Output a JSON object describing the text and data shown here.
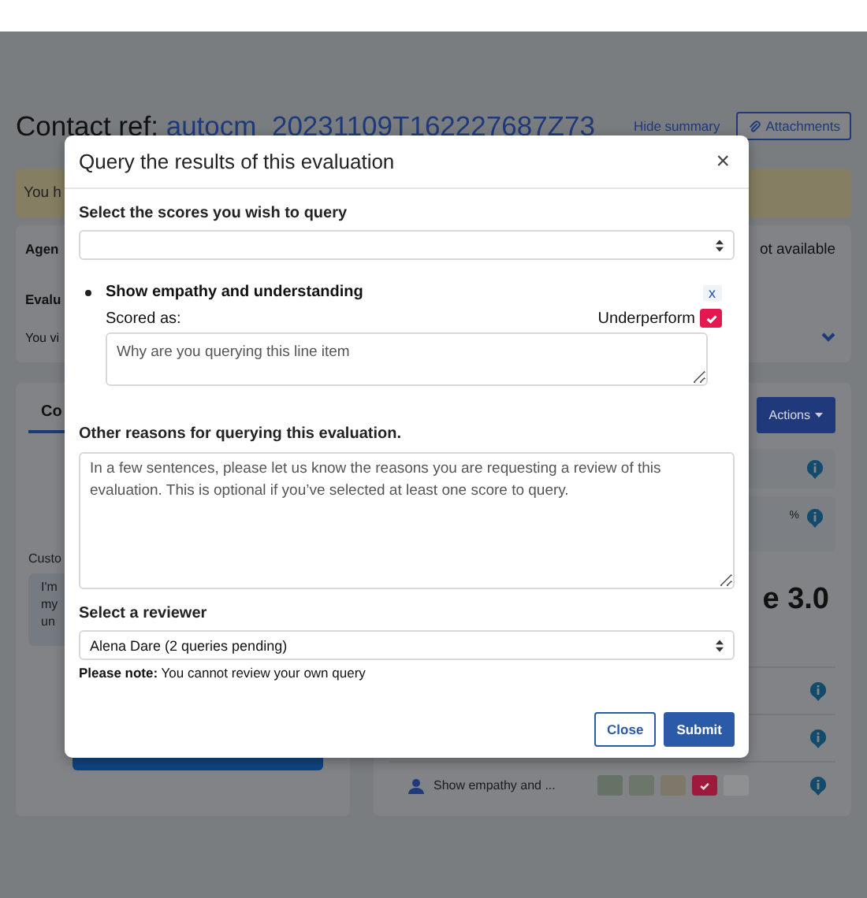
{
  "page": {
    "heading": "Contact ref:",
    "contact_ref": "autocm_20231109T162227687Z73",
    "hide_summary": "Hide summary",
    "attachments": "Attachments",
    "alert_text": "You h",
    "summary": {
      "agent_label": "Agen",
      "status_text": "ot available",
      "evaluation_label": "Evalu",
      "evaluation_text": "You vi"
    },
    "left_tab": "Co",
    "customer_label": "Custo",
    "message_lines": [
      "I'm",
      "my",
      "un"
    ],
    "actions": "Actions",
    "percent": "%",
    "score_title": "e 3.0",
    "score_row": {
      "label": "Show empathy and ...",
      "chips": [
        {
          "color": "#667266",
          "selected": false
        },
        {
          "color": "#6d766b",
          "selected": false
        },
        {
          "color": "#7d786a",
          "selected": false
        },
        {
          "color": "#9e1a3c",
          "selected": true
        },
        {
          "color": "#8e9092",
          "selected": false
        }
      ]
    }
  },
  "modal": {
    "title": "Query the results of this evaluation",
    "close": "×",
    "scores_label": "Select the scores you wish to query",
    "items": [
      {
        "name": "Show empathy and understanding",
        "remove": "x",
        "scored_label": "Scored as:",
        "score": "Underperform",
        "score_checked": true,
        "placeholder": "Why are you querying this line item"
      }
    ],
    "other_label": "Other reasons for querying this evaluation.",
    "other_placeholder": "In a few sentences, please let us know the reasons you are requesting a review of this evaluation. This is optional if you’ve selected at least one score to query.",
    "reviewer_label": "Select a reviewer",
    "reviewer_value": "Alena Dare (2 queries pending)",
    "note": "**Please note:** You cannot review your own query",
    "buttons": [
      {
        "label": "Close",
        "kind": "secondary"
      },
      {
        "label": "Submit",
        "kind": "primary"
      }
    ]
  }
}
